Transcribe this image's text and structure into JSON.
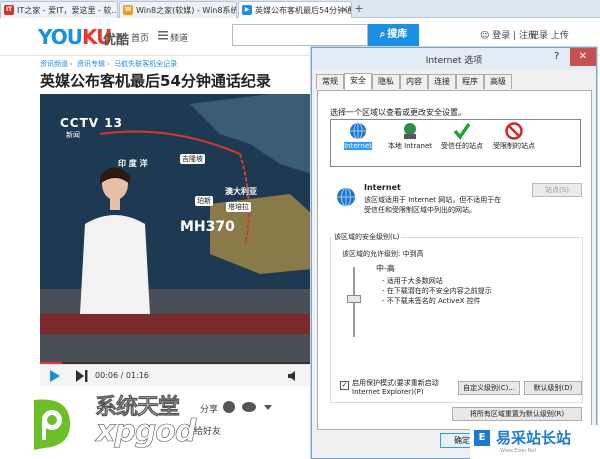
{
  "browser": {
    "tabs": [
      {
        "label": "IT之家 - 爱IT，爱这里 - 软...",
        "icon_color": "#d0342c",
        "icon_text": "IT"
      },
      {
        "label": "Win8之家(软媒) - Win8系统下...",
        "icon_color": "#e8a020",
        "icon_text": "W"
      },
      {
        "label": "英媒公布客机最后54分钟通...",
        "icon_color": "#1a8fe3",
        "icon_text": "▶",
        "active": true
      }
    ],
    "new_tab_symbol": "+"
  },
  "youku": {
    "logo_part1": "YOU",
    "logo_part2": "KU",
    "logo_cn": "优酷",
    "nav_home": "首页",
    "nav_channel": "频道",
    "search_placeholder": "",
    "search_button": "搜库",
    "user_links": "登录 | 注册",
    "right_links": "记录   上传",
    "breadcrumb": [
      "资讯频道",
      "资讯专辑",
      "马航失联客机全记录"
    ],
    "video_title": "英媒公布客机最后54分钟通话纪录",
    "player": {
      "channel_logo": "CCTV 13",
      "channel_sub": "新闻",
      "map_labels": [
        "印 度 洋",
        "澳大利亚"
      ],
      "map_tags": [
        "吉隆坡",
        "珀斯",
        "塔培拉"
      ],
      "flight_label": "MH370",
      "time_display": "00:06 / 01:16",
      "progress_fraction": 0.08
    },
    "share_label": "分享",
    "friend_label": "给好友"
  },
  "watermark": {
    "line1": "系统天堂",
    "line2": "xpgod",
    "site_name": "易采站长站",
    "site_url": "Www.Eiser.Net"
  },
  "dialog": {
    "title": "Internet 选项",
    "help_symbol": "?",
    "close_symbol": "✕",
    "tabs": [
      "常规",
      "安全",
      "隐私",
      "内容",
      "连接",
      "程序",
      "高级"
    ],
    "active_tab": 1,
    "zone_prompt": "选择一个区域以查看或更改安全设置。",
    "zones": [
      {
        "label": "Internet",
        "icon": "globe-icon",
        "color": "#1f74c8"
      },
      {
        "label": "本地 Intranet",
        "icon": "intranet-icon",
        "color": "#2a8f4a"
      },
      {
        "label": "受信任的站点",
        "icon": "check-icon",
        "color": "#25a032"
      },
      {
        "label": "受限制的站点",
        "icon": "no-entry-icon",
        "color": "#d0282c"
      }
    ],
    "selected_zone_title": "Internet",
    "selected_zone_desc": "该区域适用于 Internet 网站，但不适用于在受信任和受限制区域中列出的网站。",
    "sites_button": "站点(S)",
    "security_level_group": "该区域的安全级别(L)",
    "allowed_levels": "该区域的允许级别: 中到高",
    "level_name": "中-高",
    "level_desc": [
      "- 适用于大多数网站",
      "- 在下载潜在的不安全内容之前提示",
      "- 不下载未签名的 ActiveX 控件"
    ],
    "protected_mode_label": "启用保护模式(要求重新启动 Internet Explorer)(P)",
    "protected_mode_checked": true,
    "custom_level_button": "自定义级别(C)...",
    "default_level_button": "默认级别(D)",
    "reset_all_button": "将所有区域重置为默认级别(R)",
    "ok_button": "确定"
  }
}
